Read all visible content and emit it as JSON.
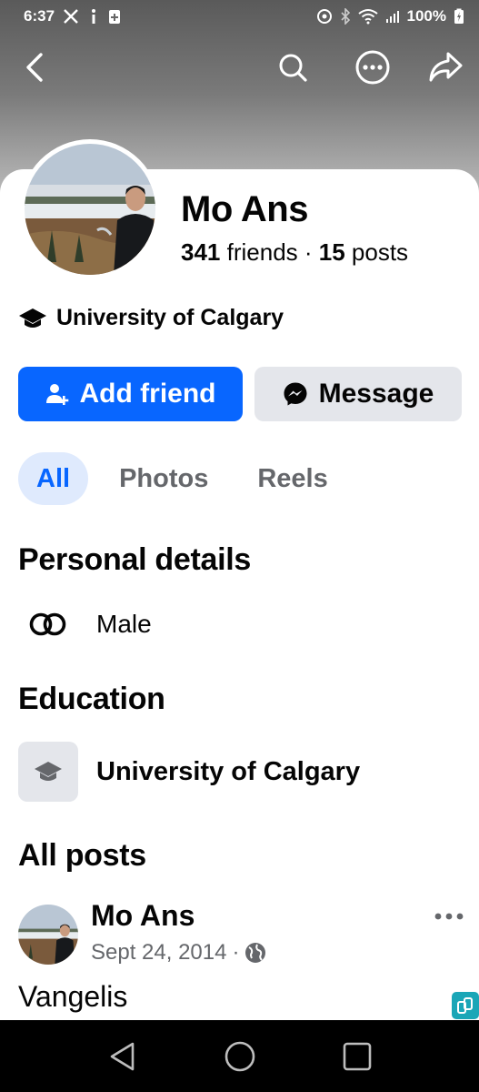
{
  "status_bar": {
    "time": "6:37",
    "battery": "100%"
  },
  "profile": {
    "name": "Mo Ans",
    "friends_count": "341",
    "friends_label": " friends",
    "separator": " · ",
    "posts_count": "15",
    "posts_label": " posts",
    "school": "University of Calgary"
  },
  "actions": {
    "add_friend": "Add friend",
    "message": "Message"
  },
  "tabs": [
    {
      "label": "All",
      "active": true
    },
    {
      "label": "Photos",
      "active": false
    },
    {
      "label": "Reels",
      "active": false
    }
  ],
  "personal_details": {
    "title": "Personal details",
    "gender": "Male"
  },
  "education": {
    "title": "Education",
    "school": "University of Calgary"
  },
  "posts": {
    "title": "All posts",
    "items": [
      {
        "author": "Mo Ans",
        "date": "Sept 24, 2014",
        "separator": "·",
        "text": "Vangelis"
      }
    ]
  },
  "colors": {
    "accent": "#0866ff",
    "secondary_button": "#e4e6eb",
    "active_tab_bg": "#dfeafd",
    "muted_text": "#65676b"
  },
  "icons": {
    "back": "back-arrow-icon",
    "search": "search-icon",
    "more": "more-icon",
    "share": "share-icon",
    "education": "graduation-cap-icon",
    "add_friend": "add-person-icon",
    "message": "messenger-icon",
    "gender": "gender-icon",
    "privacy": "globe-icon"
  }
}
